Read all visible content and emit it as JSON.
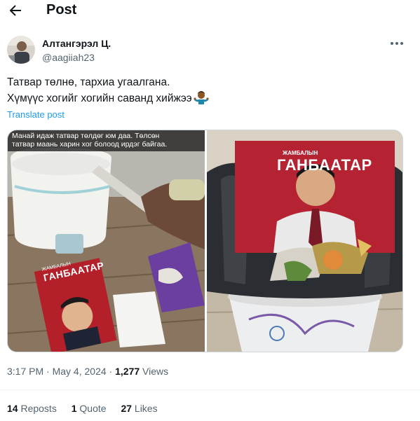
{
  "header": {
    "title": "Post"
  },
  "author": {
    "name": "Алтангэрэл Ц.",
    "handle": "@aagiiah23"
  },
  "tweet": {
    "line1": "Татвар төлнө, тархиа угаалгана.",
    "line2": "Хүмүүс хогийг хогийн саванд хийжээ",
    "translate": "Translate post"
  },
  "media": {
    "caption_line1": "Манай идаж татвар төлдөг юм даа. Төлсөн",
    "caption_line2": "татвар маань харин хог болоод ирдэг байгаа.",
    "book_left_title_small": "ЖАМБАЛЫН",
    "book_left_title_big": "ГАНБААТАР",
    "book_right_title_small": "ЖАМБАЛЫН",
    "book_right_title_big": "ГАНБААТАР"
  },
  "meta": {
    "time": "3:17 PM",
    "sep1": " · ",
    "date": "May 4, 2024",
    "sep2": " · ",
    "views_count": "1,277",
    "views_label": " Views"
  },
  "stats": {
    "reposts_count": "14",
    "reposts_label": " Reposts",
    "quotes_count": "1",
    "quotes_label": " Quote",
    "likes_count": "27",
    "likes_label": " Likes"
  },
  "colors": {
    "link": "#1d9bf0",
    "muted": "#536471",
    "text": "#0f1419"
  }
}
